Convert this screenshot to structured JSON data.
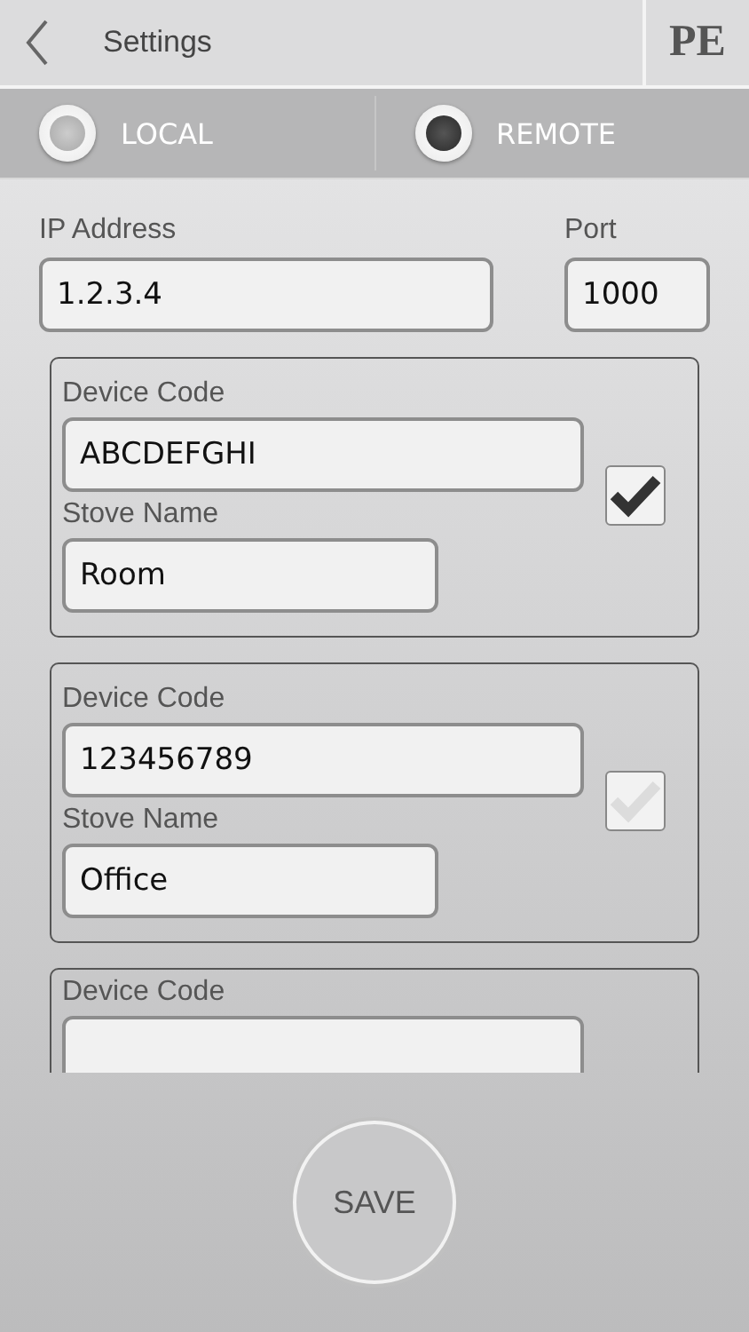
{
  "header": {
    "title": "Settings",
    "logo": "PE"
  },
  "modes": [
    {
      "label": "LOCAL",
      "selected": false
    },
    {
      "label": "REMOTE",
      "selected": true
    }
  ],
  "server": {
    "ip_label": "IP Address",
    "ip": "1.2.3.4",
    "port_label": "Port",
    "port": "1000"
  },
  "devices": [
    {
      "code_label": "Device Code",
      "code": "ABCDEFGHI",
      "name_label": "Stove Name",
      "name": "Room",
      "checked": true
    },
    {
      "code_label": "Device Code",
      "code": "123456789",
      "name_label": "Stove Name",
      "name": "Office",
      "checked": false
    },
    {
      "code_label": "Device Code"
    }
  ],
  "save": "SAVE"
}
